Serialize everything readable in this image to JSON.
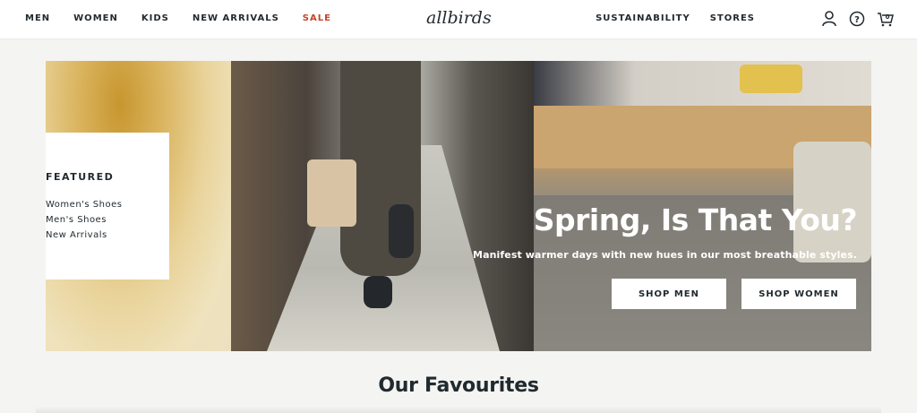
{
  "nav": {
    "left": [
      "MEN",
      "WOMEN",
      "KIDS",
      "NEW ARRIVALS",
      "SALE"
    ],
    "logo": "allbirds",
    "right": [
      "SUSTAINABILITY",
      "STORES"
    ],
    "icons": [
      "account-icon",
      "help-icon",
      "cart-icon"
    ],
    "cart_count": "0",
    "sale_color": "#c4452b"
  },
  "featured": {
    "title": "FEATURED",
    "links": [
      "Women's Shoes",
      "Men's Shoes",
      "New Arrivals"
    ]
  },
  "hero": {
    "headline": "Spring, Is That You?",
    "subline": "Manifest warmer days with new hues in our most breathable styles.",
    "shop_men": "SHOP MEN",
    "shop_women": "SHOP WOMEN"
  },
  "section": {
    "title": "Our Favourites"
  }
}
